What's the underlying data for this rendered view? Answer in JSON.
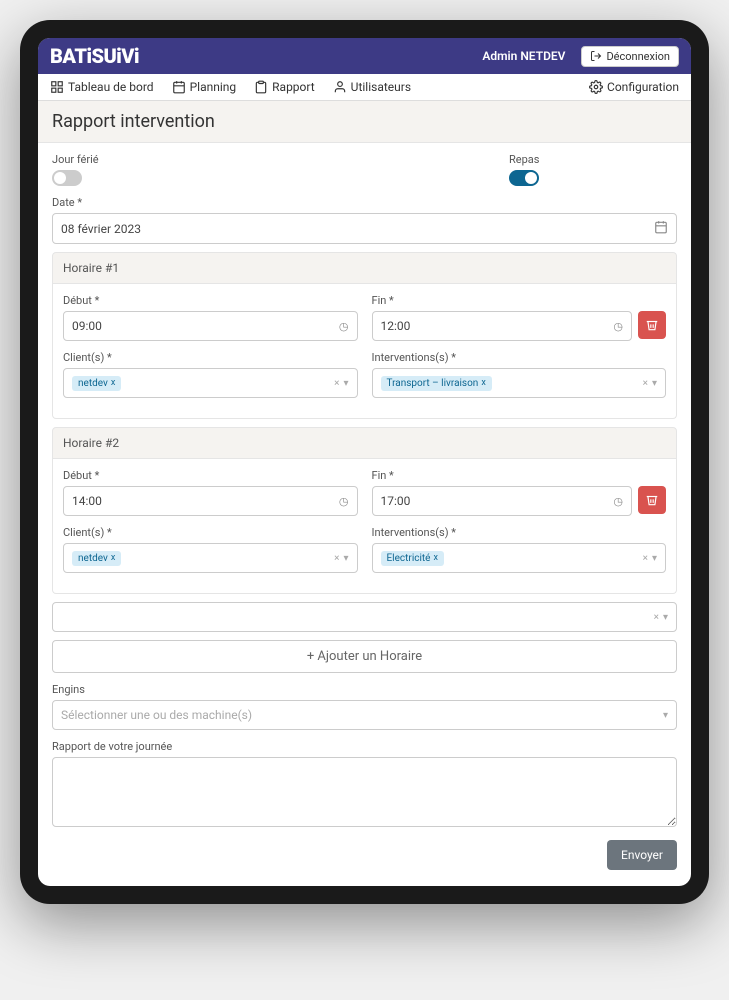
{
  "app": {
    "logo": "BATiSUiVi"
  },
  "header": {
    "user": "Admin NETDEV",
    "logout": "Déconnexion"
  },
  "nav": {
    "dashboard": "Tableau de bord",
    "planning": "Planning",
    "rapport": "Rapport",
    "users": "Utilisateurs",
    "config": "Configuration"
  },
  "page": {
    "title": "Rapport intervention"
  },
  "form": {
    "jour_ferie_label": "Jour férié",
    "repas_label": "Repas",
    "date_label": "Date *",
    "date_value": "08 février 2023",
    "horaire1": "Horaire #1",
    "horaire2": "Horaire #2",
    "debut_label": "Début *",
    "fin_label": "Fin *",
    "clients_label": "Client(s) *",
    "interventions_label": "Interventions(s) *",
    "h1_debut": "09:00",
    "h1_fin": "12:00",
    "h1_client": "netdev",
    "h1_intervention": "Transport – livraison",
    "h2_debut": "14:00",
    "h2_fin": "17:00",
    "h2_client": "netdev",
    "h2_intervention": "Electricité",
    "add_horaire": "+ Ajouter un Horaire",
    "engins_label": "Engins",
    "engins_placeholder": "Sélectionner une ou des machine(s)",
    "rapport_label": "Rapport de votre journée",
    "submit": "Envoyer",
    "tag_x": "x"
  }
}
